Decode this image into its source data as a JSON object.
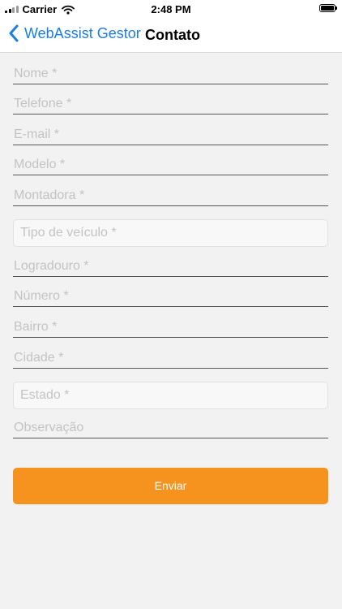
{
  "status_bar": {
    "carrier": "Carrier",
    "time": "2:48 PM"
  },
  "nav": {
    "back_label": "WebAssist Gestor",
    "title": "Contato"
  },
  "form": {
    "fields": [
      {
        "placeholder": "Nome *",
        "type": "text"
      },
      {
        "placeholder": "Telefone *",
        "type": "text"
      },
      {
        "placeholder": "E-mail *",
        "type": "text"
      },
      {
        "placeholder": "Modelo *",
        "type": "text"
      },
      {
        "placeholder": "Montadora *",
        "type": "text"
      },
      {
        "placeholder": "Tipo de veículo *",
        "type": "select"
      },
      {
        "placeholder": "Logradouro *",
        "type": "text"
      },
      {
        "placeholder": "Número *",
        "type": "text"
      },
      {
        "placeholder": "Bairro *",
        "type": "text"
      },
      {
        "placeholder": "Cidade *",
        "type": "text"
      },
      {
        "placeholder": "Estado *",
        "type": "select"
      },
      {
        "placeholder": "Observação",
        "type": "text"
      }
    ],
    "submit_label": "Enviar"
  },
  "colors": {
    "accent": "#1a7ee6",
    "button": "#f6921e",
    "background": "#f2f2f3"
  }
}
